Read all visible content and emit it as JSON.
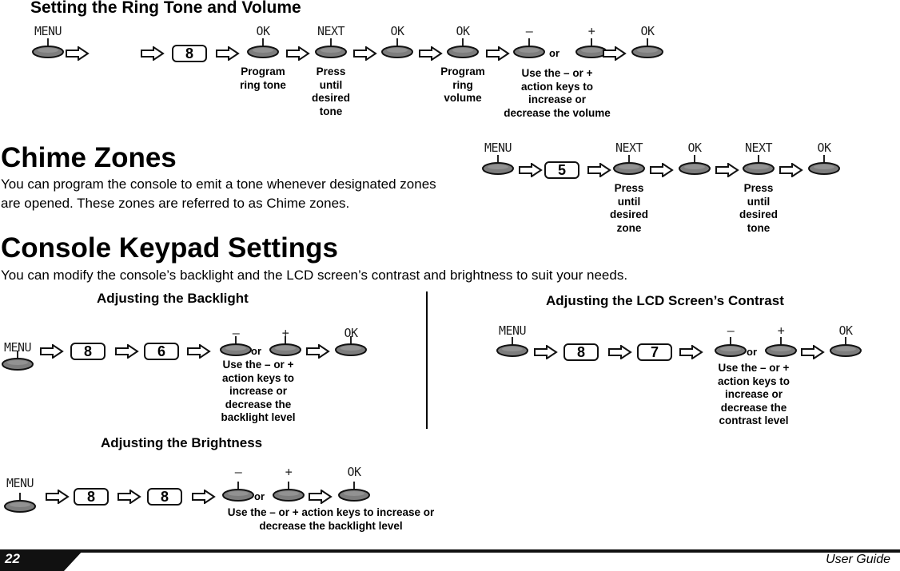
{
  "sections": {
    "ring_tone": {
      "title": "Setting the Ring Tone and Volume"
    },
    "chime": {
      "title": "Chime Zones",
      "body": "You can program the console to emit a tone whenever designated zones are opened. These zones are referred to as Chime zones."
    },
    "keypad": {
      "title": "Console Keypad Settings",
      "body": "You can modify the console’s backlight and the LCD screen’s contrast and brightness to suit your needs.",
      "backlight_title": "Adjusting the Backlight",
      "contrast_title": "Adjusting the LCD Screen’s Contrast",
      "brightness_title": "Adjusting the Brightness"
    }
  },
  "flows": {
    "ring_tone": [
      {
        "type": "button",
        "label": "MENU"
      },
      {
        "type": "arrow"
      },
      {
        "type": "arrow"
      },
      {
        "type": "numkey",
        "label": "8"
      },
      {
        "type": "arrow"
      },
      {
        "type": "button",
        "label": "OK",
        "caption": "Program\nring tone"
      },
      {
        "type": "arrow"
      },
      {
        "type": "button",
        "label": "NEXT",
        "caption": "Press\nuntil\ndesired\ntone"
      },
      {
        "type": "arrow"
      },
      {
        "type": "button",
        "label": "OK"
      },
      {
        "type": "arrow"
      },
      {
        "type": "button",
        "label": "OK",
        "caption": "Program\nring\nvolume"
      },
      {
        "type": "arrow"
      },
      {
        "type": "button",
        "label": "–"
      },
      {
        "type": "or",
        "label": "or"
      },
      {
        "type": "button",
        "label": "+"
      },
      {
        "type": "arrow"
      },
      {
        "type": "button",
        "label": "OK"
      }
    ],
    "ring_tone_caption": "Use the – or +\naction keys to\nincrease or\ndecrease the volume",
    "chime": [
      {
        "type": "button",
        "label": "MENU"
      },
      {
        "type": "arrow"
      },
      {
        "type": "numkey",
        "label": "5"
      },
      {
        "type": "arrow"
      },
      {
        "type": "button",
        "label": "NEXT",
        "caption": "Press\nuntil\ndesired\nzone"
      },
      {
        "type": "arrow"
      },
      {
        "type": "button",
        "label": "OK"
      },
      {
        "type": "arrow"
      },
      {
        "type": "button",
        "label": "NEXT",
        "caption": "Press\nuntil\ndesired\ntone"
      },
      {
        "type": "arrow"
      },
      {
        "type": "button",
        "label": "OK"
      }
    ],
    "backlight": [
      {
        "type": "button",
        "label": "MENU"
      },
      {
        "type": "arrow"
      },
      {
        "type": "numkey",
        "label": "8"
      },
      {
        "type": "arrow"
      },
      {
        "type": "numkey",
        "label": "6"
      },
      {
        "type": "arrow"
      },
      {
        "type": "button",
        "label": "–"
      },
      {
        "type": "or",
        "label": "or"
      },
      {
        "type": "button",
        "label": "+"
      },
      {
        "type": "arrow"
      },
      {
        "type": "button",
        "label": "OK"
      }
    ],
    "backlight_caption": "Use the – or +\naction keys to\nincrease or\ndecrease the\nbacklight level",
    "contrast": [
      {
        "type": "button",
        "label": "MENU"
      },
      {
        "type": "arrow"
      },
      {
        "type": "numkey",
        "label": "8"
      },
      {
        "type": "arrow"
      },
      {
        "type": "numkey",
        "label": "7"
      },
      {
        "type": "arrow"
      },
      {
        "type": "button",
        "label": "–"
      },
      {
        "type": "or",
        "label": "or"
      },
      {
        "type": "button",
        "label": "+"
      },
      {
        "type": "arrow"
      },
      {
        "type": "button",
        "label": "OK"
      }
    ],
    "contrast_caption": "Use the – or +\naction keys to\nincrease or\ndecrease the\ncontrast level",
    "brightness": [
      {
        "type": "button",
        "label": "MENU"
      },
      {
        "type": "arrow"
      },
      {
        "type": "numkey",
        "label": "8"
      },
      {
        "type": "arrow"
      },
      {
        "type": "numkey",
        "label": "8"
      },
      {
        "type": "arrow"
      },
      {
        "type": "button",
        "label": "–"
      },
      {
        "type": "or",
        "label": "or"
      },
      {
        "type": "button",
        "label": "+"
      },
      {
        "type": "arrow"
      },
      {
        "type": "button",
        "label": "OK"
      }
    ],
    "brightness_caption": "Use the – or + action keys to increase or\ndecrease the backlight level"
  },
  "footer": {
    "page_number": "22",
    "document_title": "User Guide"
  }
}
